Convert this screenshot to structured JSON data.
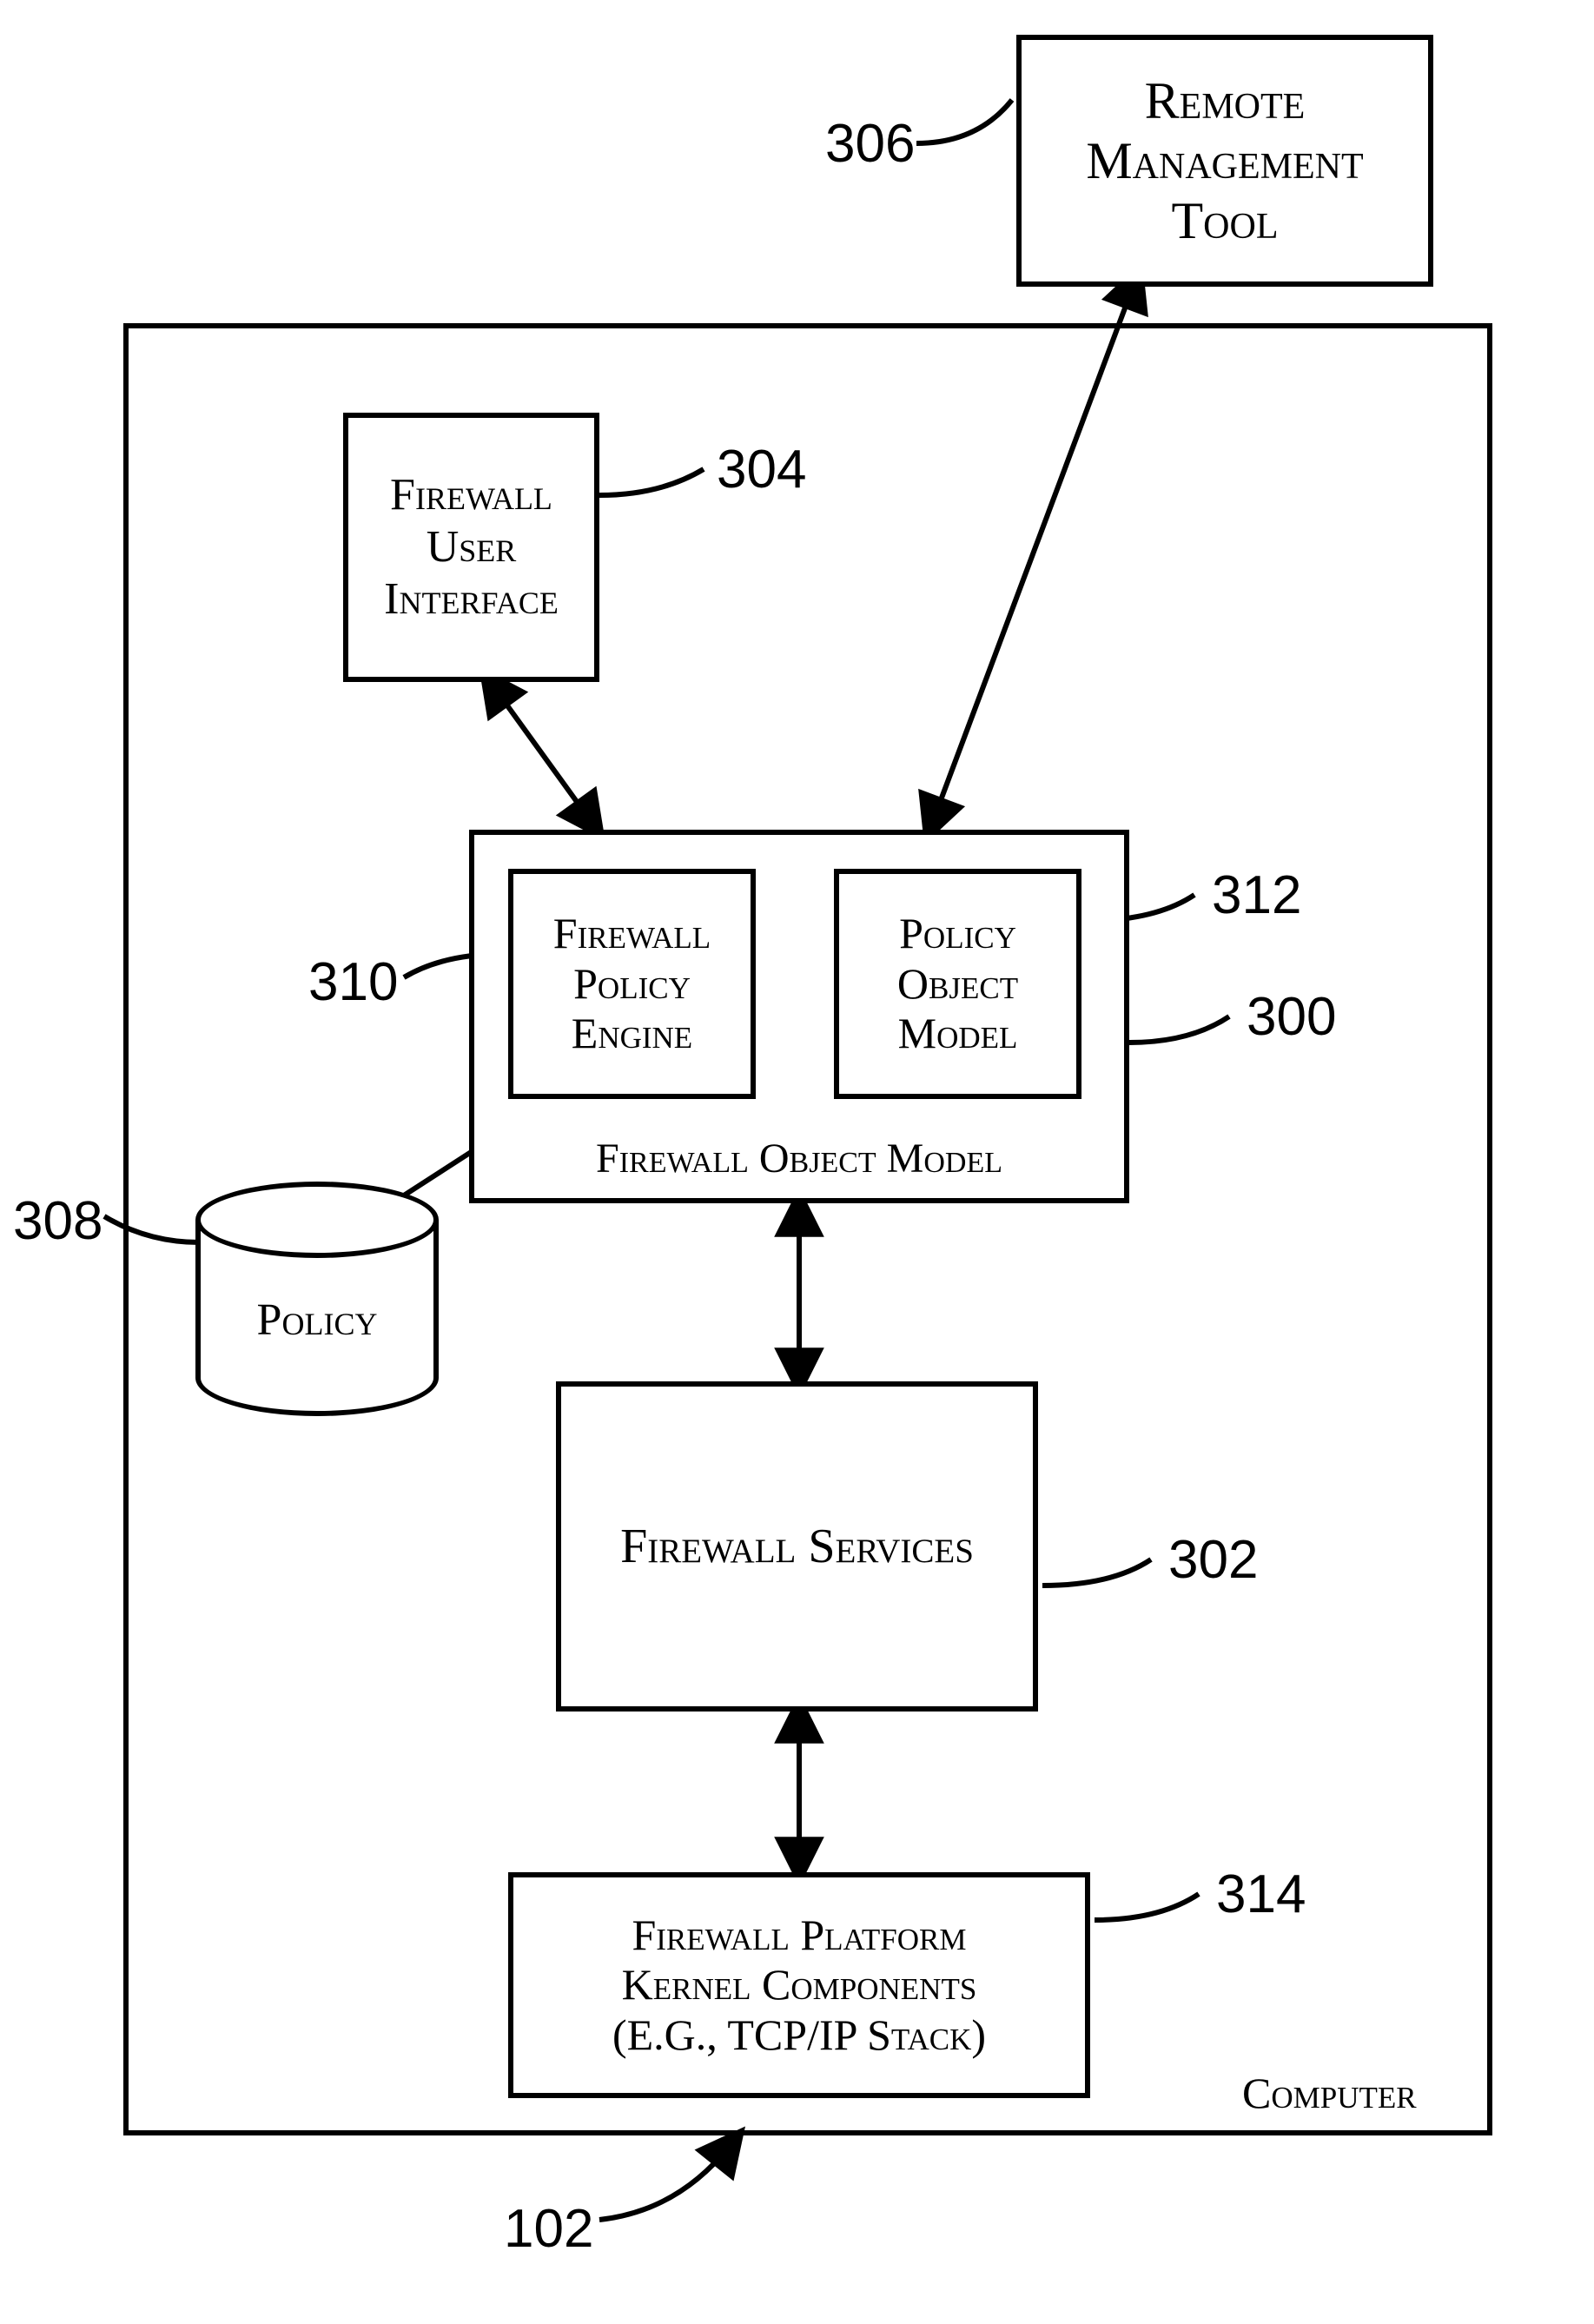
{
  "boxes": {
    "remote_mgmt": "Remote\nManagement\nTool",
    "fw_user_if": "Firewall\nUser\nInterface",
    "fw_policy_engine": "Firewall\nPolicy\nEngine",
    "policy_obj_model": "Policy\nObject\nModel",
    "fw_obj_model_caption": "Firewall Object Model",
    "fw_services": "Firewall Services",
    "fw_platform": "Firewall Platform\nKernel Components\n(e.g., TCP/IP Stack)",
    "policy_db": "Policy",
    "computer_label": "Computer"
  },
  "labels": {
    "l306": "306",
    "l304": "304",
    "l310": "310",
    "l312": "312",
    "l300": "300",
    "l308": "308",
    "l302": "302",
    "l314": "314",
    "l102": "102"
  }
}
